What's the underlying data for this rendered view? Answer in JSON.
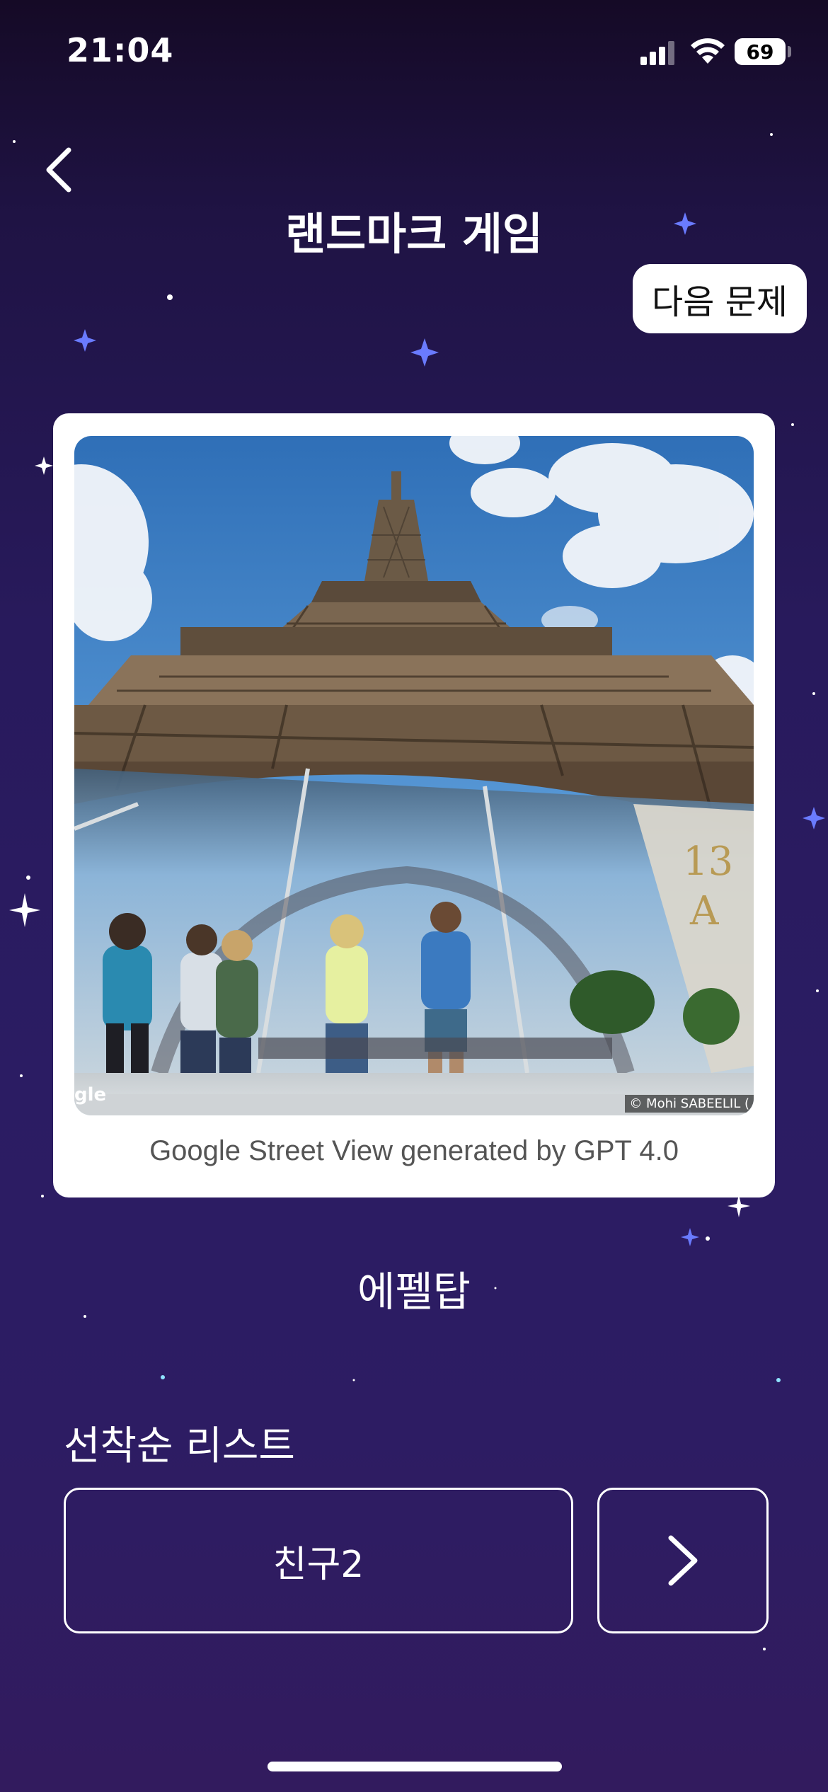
{
  "status_bar": {
    "time": "21:04",
    "battery": "69"
  },
  "header": {
    "title": "랜드마크 게임",
    "back_icon": "chevron-left-icon",
    "next_question_label": "다음 문제"
  },
  "card": {
    "image_alt": "Eiffel Tower street view",
    "credit_left": "gle",
    "credit_right": "© Mohi SABEELIL (",
    "caption": "Google Street View generated by GPT 4.0"
  },
  "answer": "에펠탑",
  "ranking": {
    "heading": "선착순 리스트",
    "first_item": "친구2",
    "next_icon": "chevron-right-icon"
  },
  "colors": {
    "background_top": "#150a26",
    "background_bottom": "#321b5e",
    "card": "#ffffff",
    "text": "#ffffff"
  }
}
